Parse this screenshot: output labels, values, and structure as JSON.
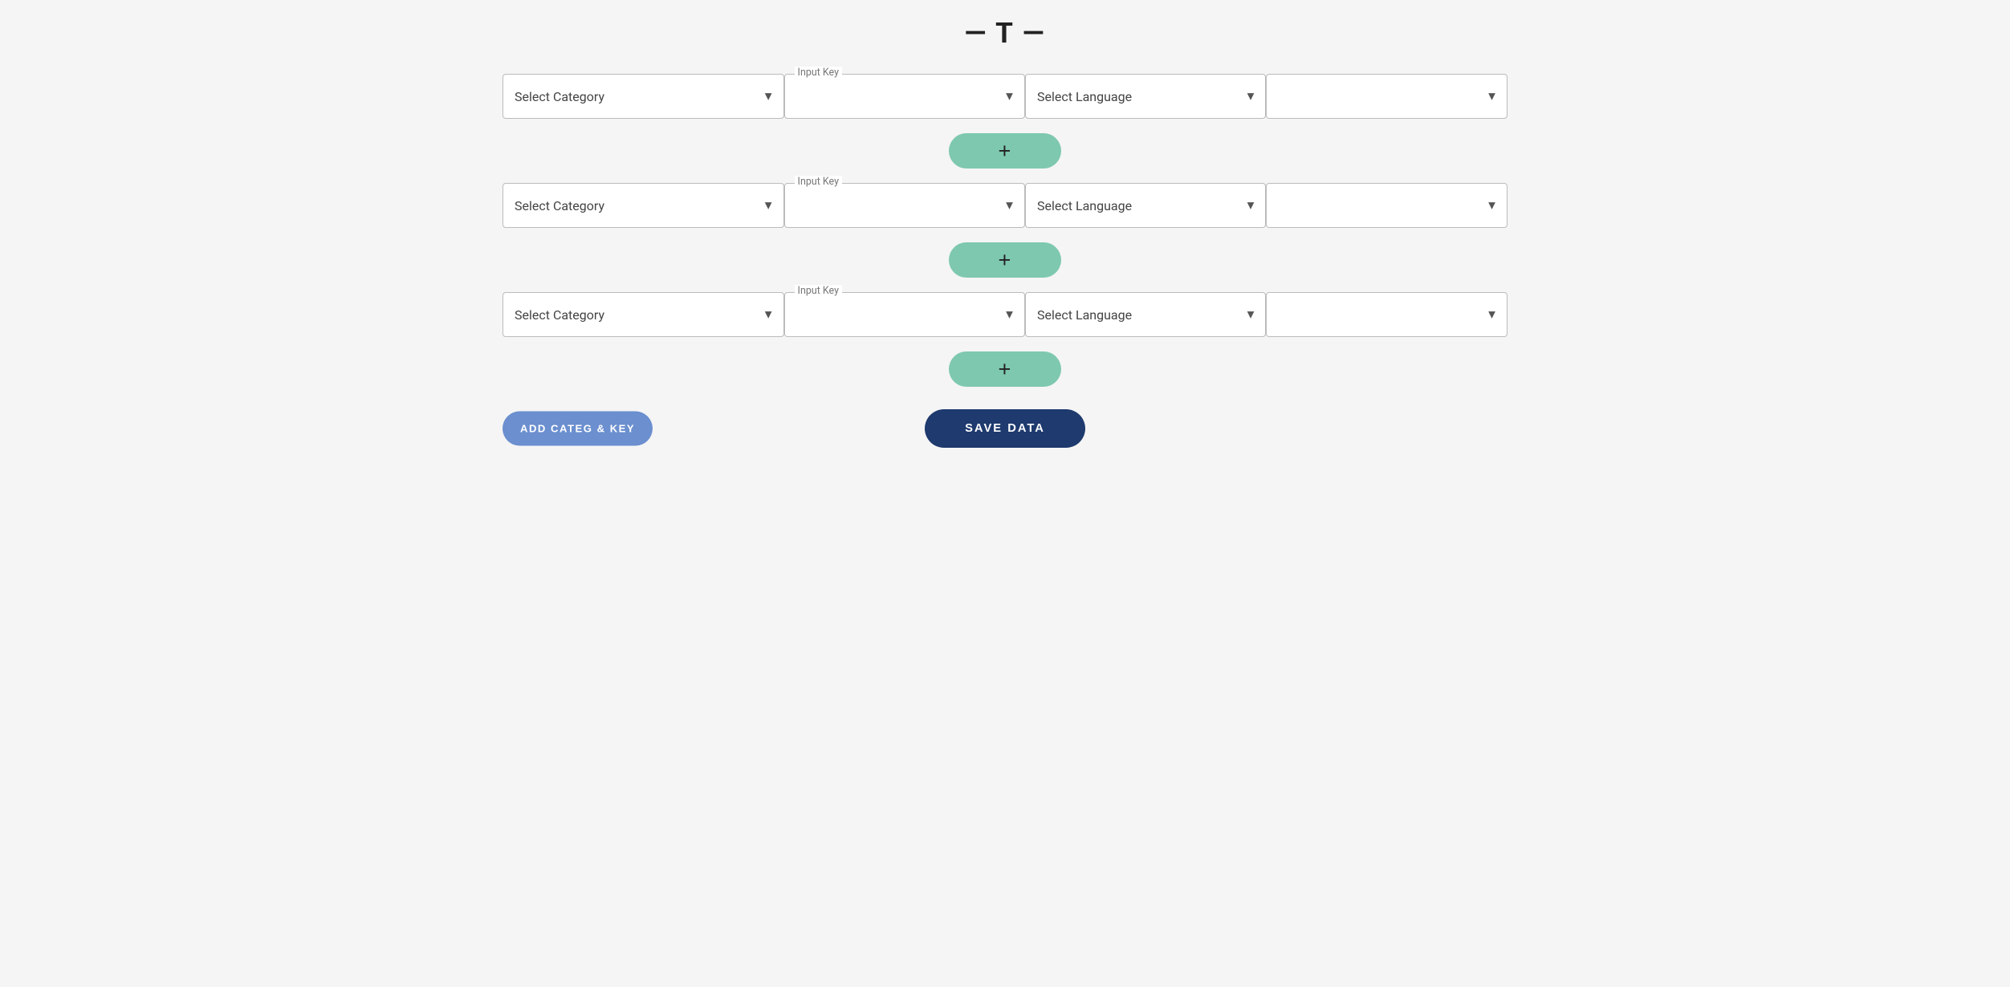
{
  "page": {
    "title": "— T —"
  },
  "rows": [
    {
      "id": "row-1",
      "category": {
        "label": "Select Category",
        "value": ""
      },
      "inputKey": {
        "label": "Input Key",
        "value": ""
      },
      "language": {
        "label": "Select Language",
        "value": ""
      },
      "lastSelect": {
        "label": "",
        "value": ""
      }
    },
    {
      "id": "row-2",
      "category": {
        "label": "Select Category",
        "value": ""
      },
      "inputKey": {
        "label": "Input Key",
        "value": ""
      },
      "language": {
        "label": "Select Language",
        "value": ""
      },
      "lastSelect": {
        "label": "",
        "value": ""
      }
    },
    {
      "id": "row-3",
      "category": {
        "label": "Select Category",
        "value": ""
      },
      "inputKey": {
        "label": "Input Key",
        "value": ""
      },
      "language": {
        "label": "Select Language",
        "value": ""
      },
      "lastSelect": {
        "label": "",
        "value": ""
      }
    }
  ],
  "buttons": {
    "plus_label": "+",
    "add_categ_key": "ADD CATEG & KEY",
    "save_data": "SAVE DATA"
  },
  "icons": {
    "chevron_down": "▾"
  }
}
